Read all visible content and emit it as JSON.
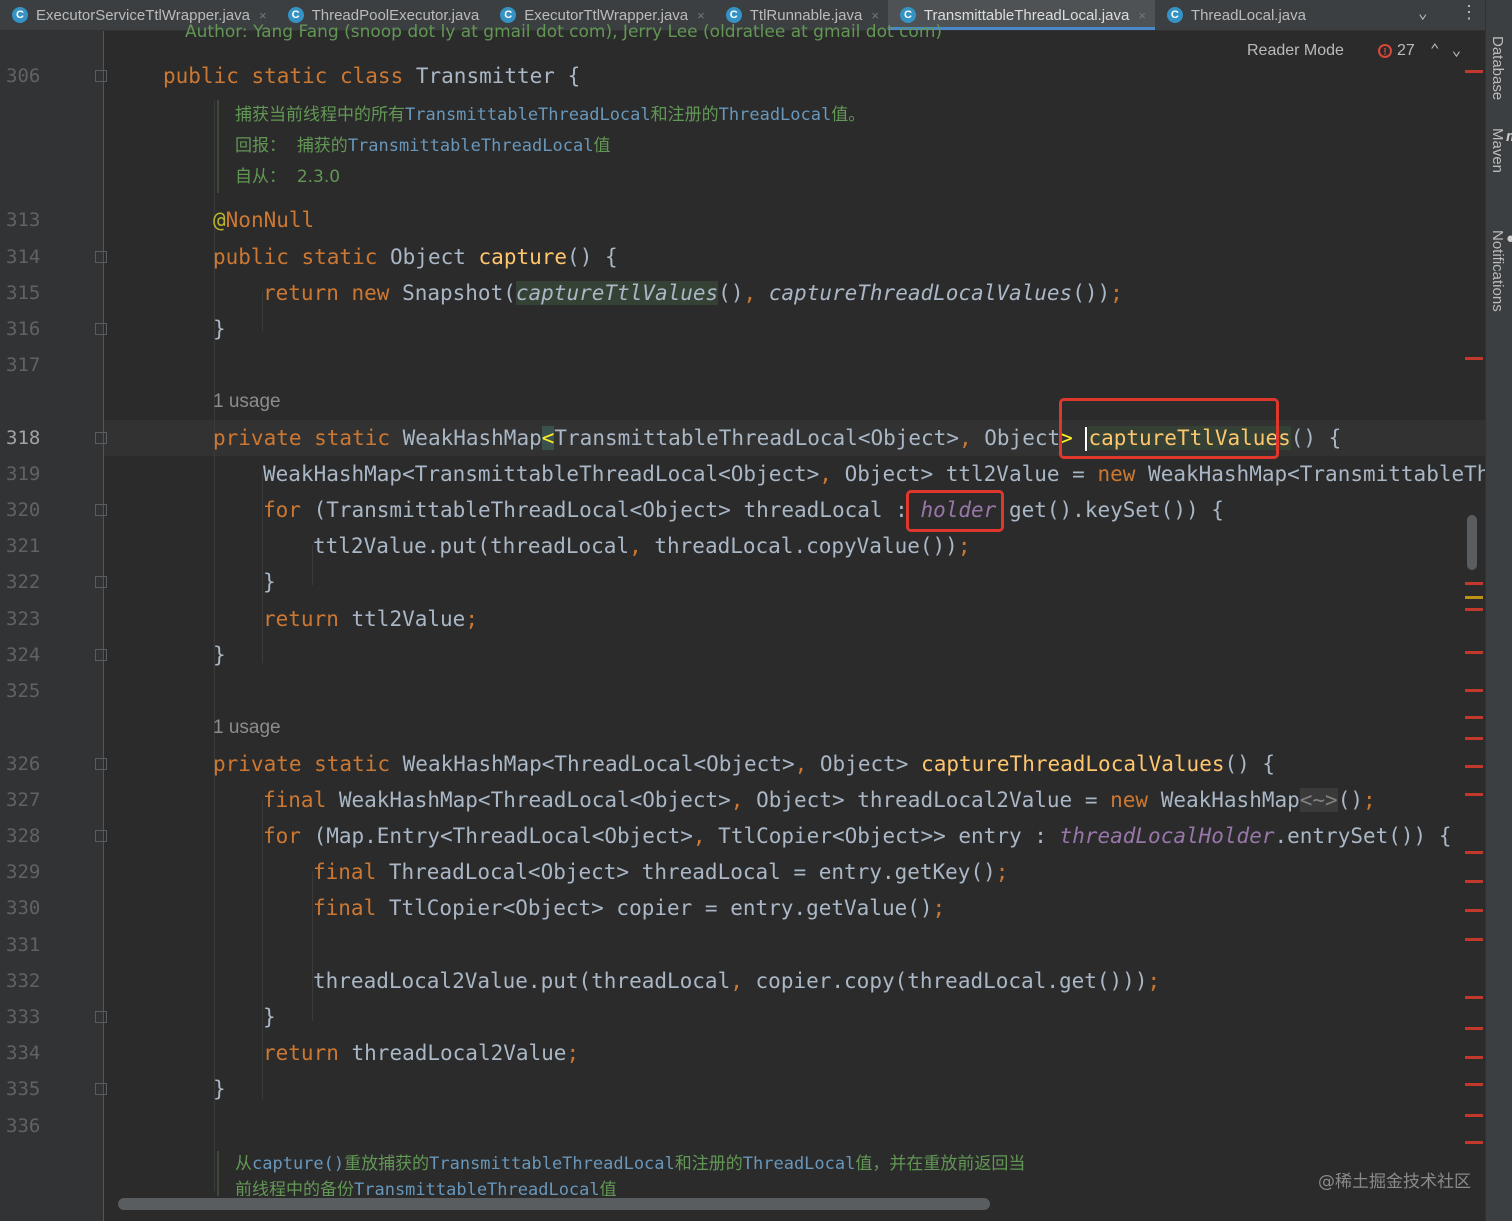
{
  "tabs": [
    {
      "label": "ExecutorServiceTtlWrapper.java",
      "icon": "c-class-icon",
      "closable": true
    },
    {
      "label": "ThreadPoolExecutor.java",
      "icon": "c-class-icon",
      "closable": false
    },
    {
      "label": "ExecutorTtlWrapper.java",
      "icon": "c-class-icon",
      "closable": true
    },
    {
      "label": "TtlRunnable.java",
      "icon": "c-class-icon",
      "closable": true
    },
    {
      "label": "TransmittableThreadLocal.java",
      "icon": "c-class-icon",
      "closable": true,
      "active": true
    },
    {
      "label": "ThreadLocal.java",
      "icon": "c-class-icon",
      "closable": false
    }
  ],
  "class_icon_letter": "C",
  "close_glyph": "×",
  "tab_overflow_glyph": "⌄",
  "more_glyph": "⋮",
  "side_tools": [
    "Database",
    "Maven",
    "Notifications"
  ],
  "editor": {
    "author_line": "Author:    Yang Fang (snoop dot ly at gmail dot com), Jerry Lee (oldratlee at gmail dot com)",
    "reader_mode": "Reader Mode",
    "error_count": "27",
    "error_icon": "!",
    "nav_up": "⌃",
    "nav_down": "⌄",
    "current_line": "318",
    "usage_hint": "1 usage",
    "doc1": {
      "l1_a": "捕获当前线程中的所有",
      "l1_b": "TransmittableThreadLocal",
      "l1_c": "和注册的",
      "l1_d": "ThreadLocal",
      "l1_e": "值。",
      "l2_label": "回报：",
      "l2_a": "捕获的",
      "l2_b": "TransmittableThreadLocal",
      "l2_c": "值",
      "l3_label": "自从：",
      "l3_value": "2.3.0"
    },
    "doc2": {
      "l1_a": "从",
      "l1_b": "capture()",
      "l1_c": "重放捕获的",
      "l1_d": "TransmittableThreadLocal",
      "l1_e": "和注册的",
      "l1_f": "ThreadLocal",
      "l1_g": "值，并在重放前返回当",
      "l2_a": "前线程中的备份",
      "l2_b": "TransmittableThreadLocal",
      "l2_c": "值"
    },
    "line_numbers": [
      "306",
      "313",
      "314",
      "315",
      "316",
      "317",
      "318",
      "319",
      "320",
      "321",
      "322",
      "323",
      "324",
      "325",
      "326",
      "327",
      "328",
      "329",
      "330",
      "331",
      "332",
      "333",
      "334",
      "335",
      "336"
    ],
    "highlight_boxes": [
      "captureTtlValues",
      "holder"
    ],
    "accent_colors": {
      "keyword": "#cc7832",
      "method": "#ffc66d",
      "static_field": "#9876aa",
      "doc_comment": "#629755",
      "highlight_box": "#e0372d"
    }
  },
  "watermark": "@稀土掘金技术社区"
}
